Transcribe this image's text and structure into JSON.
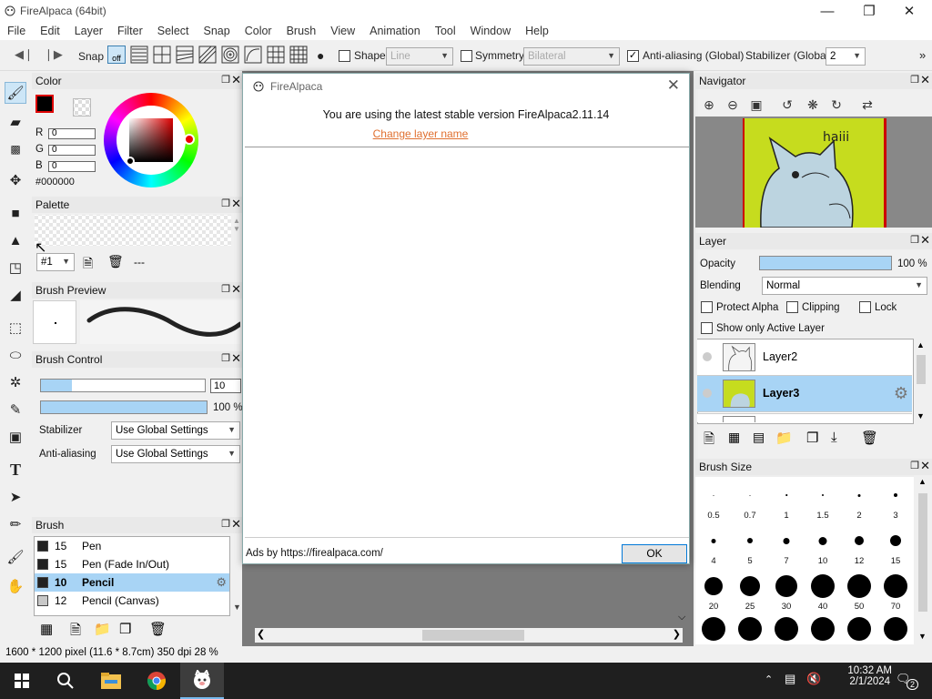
{
  "window": {
    "title": "FireAlpaca (64bit)"
  },
  "menu": [
    "File",
    "Edit",
    "Layer",
    "Filter",
    "Select",
    "Snap",
    "Color",
    "Brush",
    "View",
    "Animation",
    "Tool",
    "Window",
    "Help"
  ],
  "toolbar": {
    "snap_label": "Snap",
    "snap_off_label": "off",
    "shape_label": "Shape",
    "shape_value": "Line",
    "symmetry_label": "Symmetry",
    "symmetry_value": "Bilateral",
    "antialias_label": "Anti-aliasing (Global)",
    "stabilizer_label": "Stabilizer (Global)",
    "stabilizer_value": "2",
    "overflow": "»"
  },
  "color_panel": {
    "title": "Color",
    "r_label": "R",
    "r_value": "0",
    "g_label": "G",
    "g_value": "0",
    "b_label": "B",
    "b_value": "0",
    "hex": "#000000"
  },
  "palette_panel": {
    "title": "Palette",
    "selector": "#1",
    "name": "---"
  },
  "brush_preview_panel": {
    "title": "Brush Preview"
  },
  "brush_control_panel": {
    "title": "Brush Control",
    "size_value": "10",
    "opacity_value": "100 %",
    "stabilizer_label": "Stabilizer",
    "stabilizer_value": "Use Global Settings",
    "antialias_label": "Anti-aliasing",
    "antialias_value": "Use Global Settings"
  },
  "brush_panel": {
    "title": "Brush",
    "items": [
      {
        "size": "15",
        "name": "Pen",
        "color": "#222222"
      },
      {
        "size": "15",
        "name": "Pen (Fade In/Out)",
        "color": "#222222"
      },
      {
        "size": "10",
        "name": "Pencil",
        "color": "#222222"
      },
      {
        "size": "12",
        "name": "Pencil (Canvas)",
        "color": "#c8c8c8"
      }
    ]
  },
  "dialog": {
    "title": "FireAlpaca",
    "message": "You are using the latest stable version FireAlpaca2.11.14",
    "link": "Change layer name",
    "ads_label": "Ads by https://firealpaca.com/",
    "ok_label": "OK"
  },
  "navigator_panel": {
    "title": "Navigator",
    "drawing_text": "haiii"
  },
  "layer_panel": {
    "title": "Layer",
    "opacity_label": "Opacity",
    "opacity_value": "100 %",
    "blending_label": "Blending",
    "blending_value": "Normal",
    "protect_alpha": "Protect Alpha",
    "clipping": "Clipping",
    "lock": "Lock",
    "show_active": "Show only Active Layer",
    "layers": [
      {
        "name": "Layer2"
      },
      {
        "name": "Layer3"
      }
    ]
  },
  "brush_size_panel": {
    "title": "Brush Size",
    "sizes": [
      "0.5",
      "0.7",
      "1",
      "1.5",
      "2",
      "3",
      "4",
      "5",
      "7",
      "10",
      "12",
      "15",
      "20",
      "25",
      "30",
      "40",
      "50",
      "70"
    ]
  },
  "status": {
    "text": "1600 * 1200 pixel   (11.6 * 8.7cm)   350 dpi   28 %"
  },
  "taskbar": {
    "time": "10:32 AM",
    "date": "2/1/2024",
    "notifications": "2"
  },
  "colors": {
    "accent_blue": "#a8d4f5",
    "link_orange": "#e07030",
    "taskbar": "#1f1f1f",
    "layer_thumb_green": "#c6dc1e"
  }
}
